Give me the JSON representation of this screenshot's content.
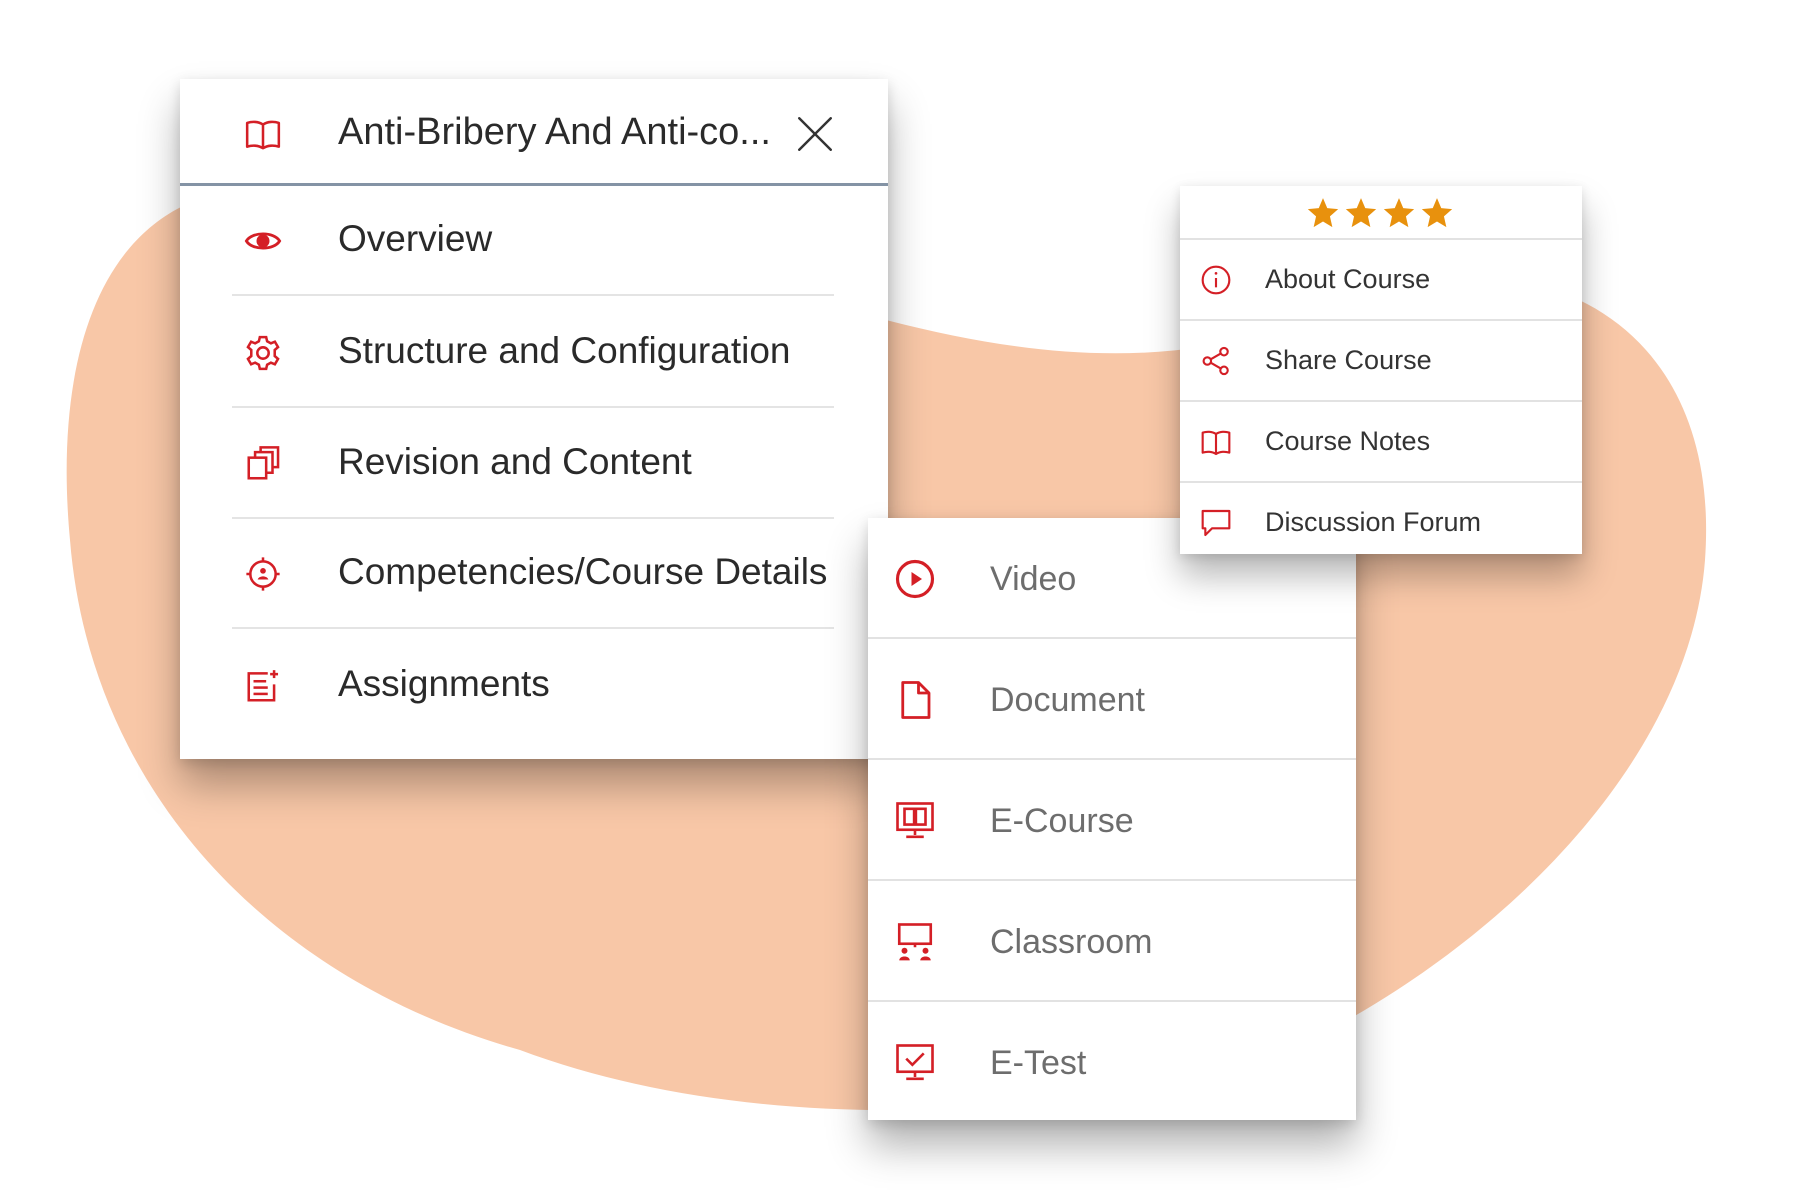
{
  "theme": {
    "accent": "#d41f26",
    "blob": "#f8c7a7",
    "star": "#e8910d",
    "divider": "#8493a5"
  },
  "course_menu": {
    "header": {
      "title": "Anti-Bribery And Anti-co...",
      "icon": "book-icon",
      "close_icon": "close-icon"
    },
    "items": [
      {
        "label": "Overview",
        "icon": "eye-icon"
      },
      {
        "label": "Structure and Configuration",
        "icon": "gear-icon"
      },
      {
        "label": "Revision and Content",
        "icon": "copy-icon"
      },
      {
        "label": "Competencies/Course Details",
        "icon": "target-icon"
      },
      {
        "label": "Assignments",
        "icon": "assignment-icon"
      }
    ]
  },
  "course_actions": {
    "rating": 4,
    "items": [
      {
        "label": "About Course",
        "icon": "info-icon"
      },
      {
        "label": "Share Course",
        "icon": "share-icon"
      },
      {
        "label": "Course Notes",
        "icon": "book-icon"
      },
      {
        "label": "Discussion Forum",
        "icon": "chat-icon"
      }
    ]
  },
  "content_types": {
    "items": [
      {
        "label": "Video",
        "icon": "play-circle-icon"
      },
      {
        "label": "Document",
        "icon": "document-icon"
      },
      {
        "label": "E-Course",
        "icon": "monitor-book-icon"
      },
      {
        "label": "Classroom",
        "icon": "classroom-icon"
      },
      {
        "label": "E-Test",
        "icon": "monitor-check-icon"
      }
    ]
  }
}
